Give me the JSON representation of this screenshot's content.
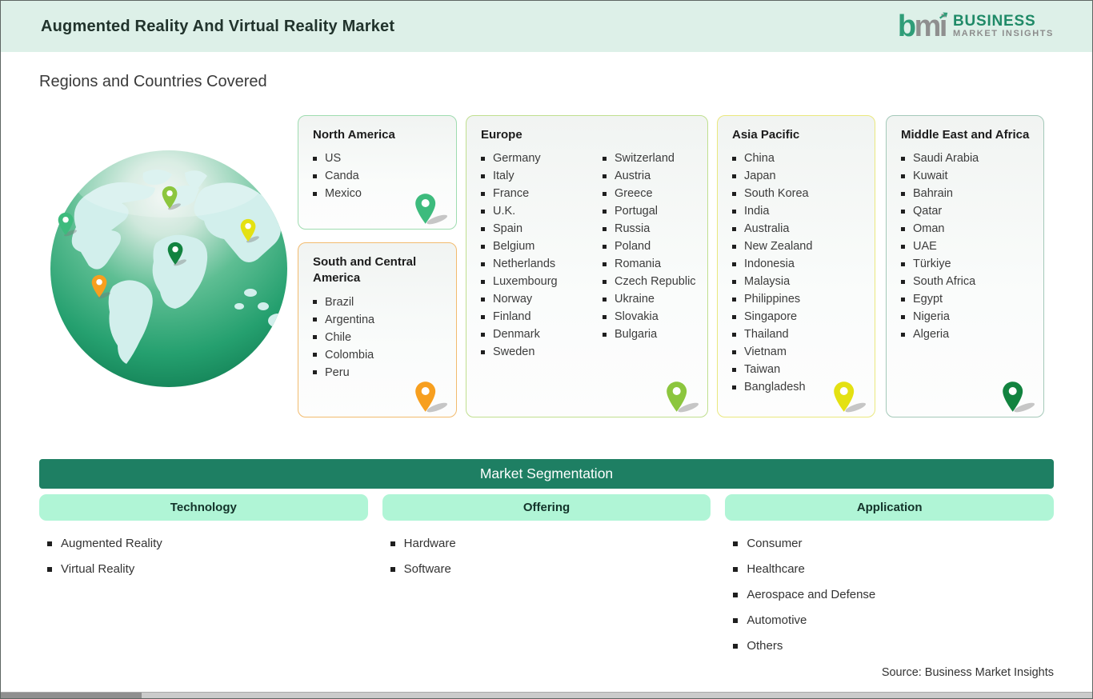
{
  "header": {
    "title": "Augmented Reality And Virtual Reality Market",
    "logo": {
      "mark_b": "b",
      "mark_m": "m",
      "mark_i": "i",
      "arrow": "➚",
      "line1": "BUSINESS",
      "line2": "MARKET INSIGHTS"
    }
  },
  "section_title": "Regions and Countries Covered",
  "regions": [
    {
      "name": "North America",
      "countries": [
        "US",
        "Canda",
        "Mexico"
      ],
      "pin_color": "#3dbb7d",
      "border_color": "#9fdcb0"
    },
    {
      "name": "South and Central America",
      "countries": [
        "Brazil",
        "Argentina",
        "Chile",
        "Colombia",
        "Peru"
      ],
      "pin_color": "#f79f1f",
      "border_color": "#f2bb6e"
    },
    {
      "name": "Europe",
      "columns": [
        [
          "Germany",
          "Italy",
          "France",
          "U.K.",
          "Spain",
          "Belgium",
          "Netherlands",
          "Luxembourg",
          "Norway",
          "Finland",
          "Denmark",
          "Sweden"
        ],
        [
          "Switzerland",
          "Austria",
          "Greece",
          "Portugal",
          "Russia",
          "Poland",
          "Romania",
          "Czech Republic",
          "Ukraine",
          "Slovakia",
          "Bulgaria"
        ]
      ],
      "pin_color": "#8cc63e",
      "border_color": "#c0df8f"
    },
    {
      "name": "Asia Pacific",
      "countries": [
        "China",
        "Japan",
        "South Korea",
        "India",
        "Australia",
        "New Zealand",
        "Indonesia",
        "Malaysia",
        "Philippines",
        "Singapore",
        "Thailand",
        "Vietnam",
        "Taiwan",
        "Bangladesh"
      ],
      "pin_color": "#e4e112",
      "border_color": "#eae87e"
    },
    {
      "name": "Middle East and Africa",
      "countries": [
        "Saudi Arabia",
        "Kuwait",
        "Bahrain",
        "Qatar",
        "Oman",
        "UAE",
        "Türkiye",
        "South Africa",
        "Egypt",
        "Nigeria",
        "Algeria"
      ],
      "pin_color": "#12833f",
      "border_color": "#a4c9b9"
    }
  ],
  "segmentation": {
    "title": "Market Segmentation",
    "columns": [
      {
        "label": "Technology",
        "items": [
          "Augmented Reality",
          "Virtual Reality"
        ]
      },
      {
        "label": "Offering",
        "items": [
          "Hardware",
          "Software"
        ]
      },
      {
        "label": "Application",
        "items": [
          "Consumer",
          "Healthcare",
          "Aerospace and Defense",
          "Automotive",
          "Others"
        ]
      }
    ]
  },
  "source": "Source: Business Market Insights",
  "colors": {
    "header_bg": "#ddf0e8",
    "seg_bar_bg": "#1e7f63",
    "pill_bg": "#b0f5d6",
    "logo_green": "#2f9d78",
    "logo_gray": "#8f8f8f",
    "globe_light_land": "#d2efec"
  }
}
